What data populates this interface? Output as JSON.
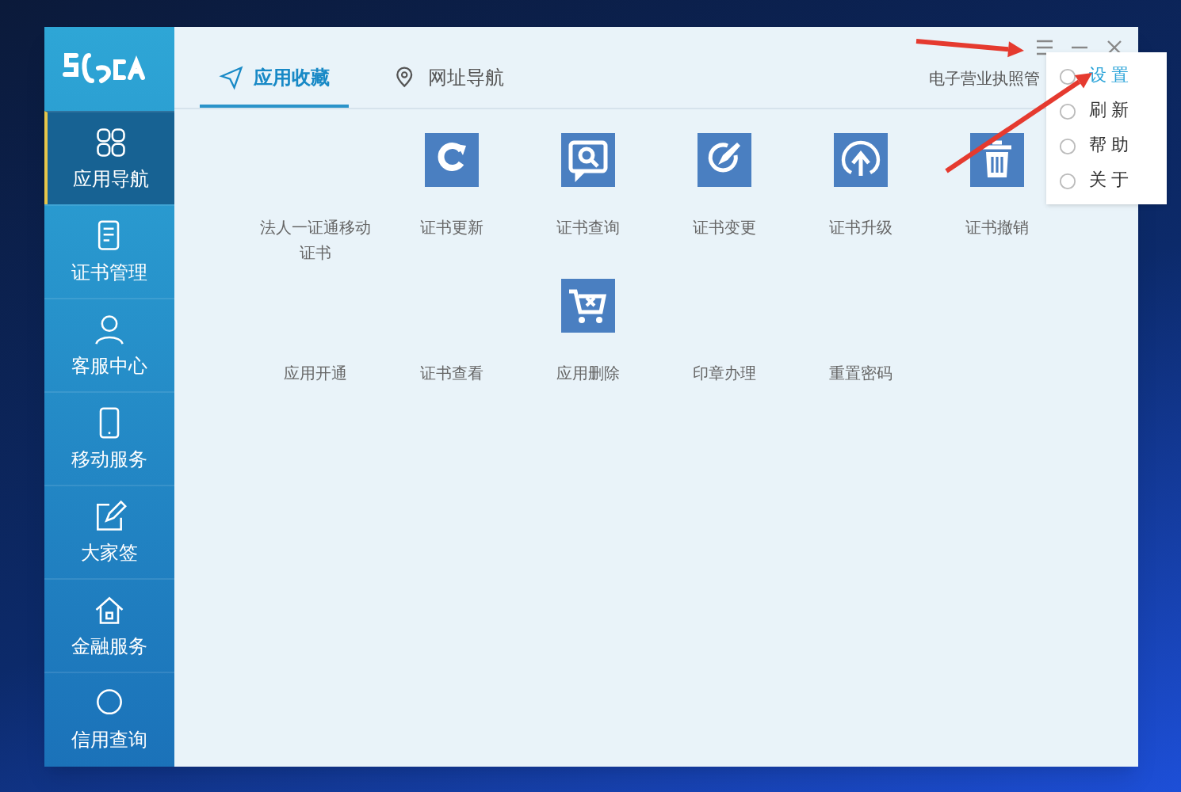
{
  "window": {
    "controls": [
      {
        "kind": "menu"
      },
      {
        "kind": "minimize"
      },
      {
        "kind": "close"
      }
    ]
  },
  "sidebar": {
    "items": [
      {
        "label": "应用导航",
        "selected": true
      },
      {
        "label": "证书管理",
        "selected": false
      },
      {
        "label": "客服中心",
        "selected": false
      },
      {
        "label": "移动服务",
        "selected": false
      },
      {
        "label": "大家签",
        "selected": false
      },
      {
        "label": "金融服务",
        "selected": false
      },
      {
        "label": "信用查询",
        "selected": false
      }
    ]
  },
  "tabs": [
    {
      "label": "应用收藏",
      "selected": true
    },
    {
      "label": "网址导航",
      "selected": false
    }
  ],
  "header_text": "电子营业执照管",
  "menu": {
    "items": [
      {
        "label": "设 置",
        "selected": true
      },
      {
        "label": "刷 新",
        "selected": false
      },
      {
        "label": "帮 助",
        "selected": false
      },
      {
        "label": "关 于",
        "selected": false
      }
    ]
  },
  "apps": [
    [
      "法人一证通移动证书",
      "证书更新",
      "证书查询",
      "证书变更",
      "证书升级",
      "证书撤销"
    ],
    [
      "应用开通",
      "证书查看",
      "应用删除",
      "印章办理",
      "重置密码"
    ]
  ],
  "annotations": [
    {
      "kind": "arrow"
    },
    {
      "kind": "arrow"
    }
  ]
}
